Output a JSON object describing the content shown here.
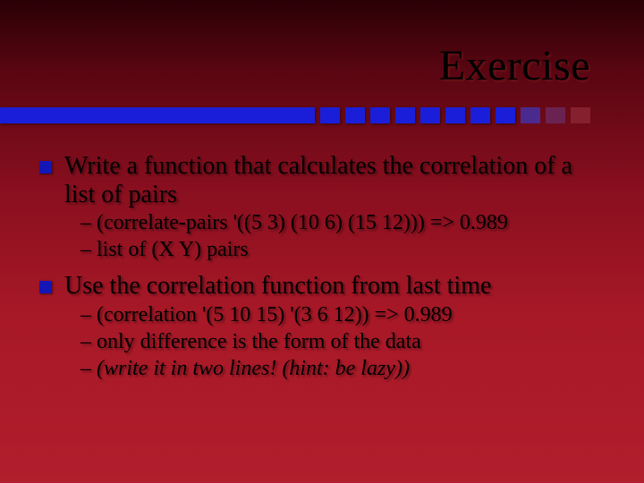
{
  "title": "Exercise",
  "p1": {
    "text": "Write a function that calculates the correlation of a list of pairs",
    "sub1": "– (correlate-pairs '((5 3) (10 6) (15 12))) => 0.989",
    "sub2": "– list of (X Y) pairs"
  },
  "p2": {
    "text": "Use the correlation function from last time",
    "sub1": "– (correlation '(5 10 15) '(3 6 12)) => 0.989",
    "sub2": "– only difference is the form of the data",
    "sub3": "– (write it in two lines! (hint:  be lazy))"
  }
}
